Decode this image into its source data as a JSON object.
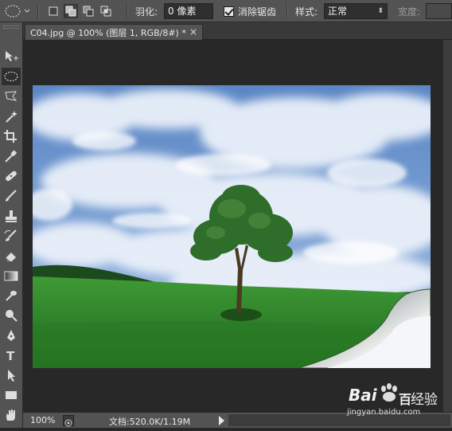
{
  "options_bar": {
    "feather_label": "羽化:",
    "feather_value": "0 像素",
    "antialias_label": "消除锯齿",
    "antialias_checked": true,
    "style_label": "样式:",
    "style_value": "正常",
    "width_label": "宽度:"
  },
  "document": {
    "tab_title": "C04.jpg @ 100% (图层 1, RGB/8#) *",
    "close_glyph": "×"
  },
  "status_bar": {
    "zoom": "100%",
    "doc_info": "文档:520.0K/1.19M"
  },
  "tools": [
    "move-tool",
    "elliptical-marquee-tool",
    "lasso-tool",
    "magic-wand-tool",
    "crop-tool",
    "eyedropper-tool",
    "spot-healing-tool",
    "brush-tool",
    "clone-stamp-tool",
    "history-brush-tool",
    "eraser-tool",
    "gradient-tool",
    "blur-tool",
    "dodge-tool",
    "pen-tool",
    "type-tool",
    "path-selection-tool",
    "rectangle-tool"
  ],
  "selected_tool": "elliptical-marquee-tool",
  "watermark": {
    "brand": "Bai",
    "brand_suffix": "百",
    "site_label": "经验",
    "url": "jingyan.baidu.com"
  },
  "colors": {
    "panel": "#535353",
    "workspace": "#282828",
    "accent_text": "#e8e8e8"
  }
}
